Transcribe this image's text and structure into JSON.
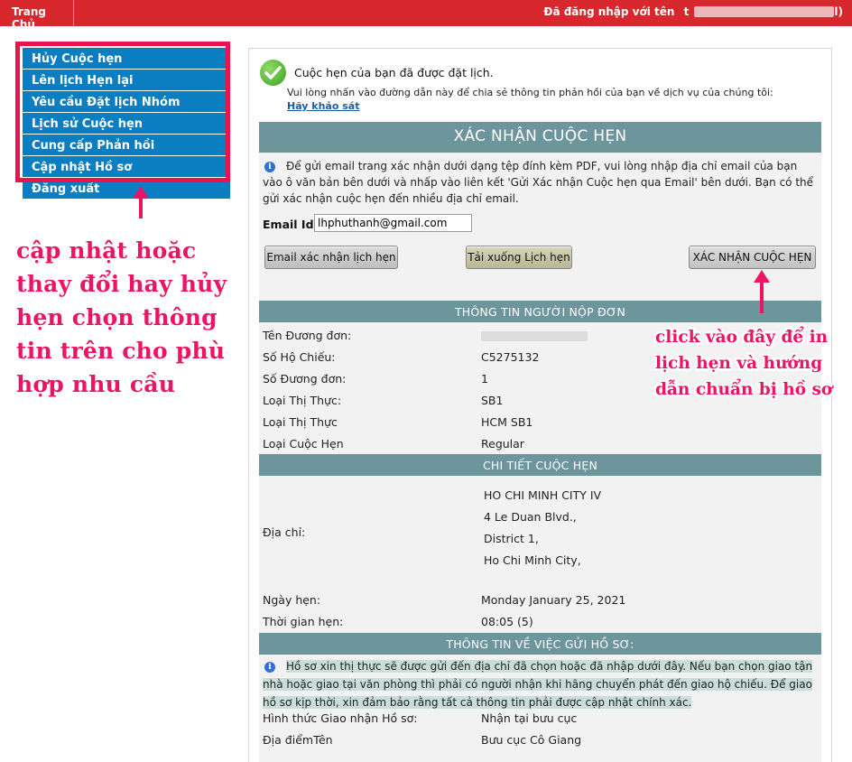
{
  "topbar": {
    "home_label": "Trang Chủ",
    "login_prefix": "Đã đăng nhập với tên",
    "login_start": "t",
    "login_end": "l)"
  },
  "sidebar": {
    "items": [
      {
        "label": "Hủy Cuộc hẹn"
      },
      {
        "label": "Lên lịch Hẹn lại"
      },
      {
        "label": "Yêu cầu Đặt lịch Nhóm"
      },
      {
        "label": "Lịch sử Cuộc hẹn"
      },
      {
        "label": "Cung cấp Phản hồi"
      },
      {
        "label": "Cập nhật Hồ sơ"
      },
      {
        "label": "Đăng xuất"
      }
    ]
  },
  "annotations": {
    "left": "cập nhật hoặc thay đổi hay hủy hẹn chọn thông tin trên cho phù hợp nhu cầu",
    "right": "click vào đây để in lịch hẹn và hướng dẫn chuẩn bị hồ sơ"
  },
  "confirm": {
    "title": "Cuộc hẹn của bạn đã được đặt lịch.",
    "survey_text": "Vui lòng nhấn vào đường dẫn này để chia sẻ thông tin phản hồi của bạn về dịch vụ của chúng tôi:",
    "survey_link": "Hãy khảo sát"
  },
  "card": {
    "title": "XÁC NHẬN CUỘC HẸN",
    "email_info": "Để gửi email trang xác nhận dưới dạng tệp đính kèm PDF, vui lòng nhập địa chỉ email của bạn vào ô văn bản bên dưới và nhấp vào liên kết 'Gửi Xác nhận Cuộc hẹn qua Email' bên dưới. Bạn có thể gửi xác nhận cuộc hẹn đến nhiều địa chỉ email.",
    "email_label": "Email Id:",
    "email_value": "lhphuthanh@gmail.com",
    "buttons": {
      "email": "Email xác nhận lịch hẹn",
      "download": "Tải xuống Lịch hẹn",
      "confirm": "XÁC NHẬN CUỘC HẸN"
    }
  },
  "applicant": {
    "heading": "THÔNG TIN NGƯỜI NỘP ĐƠN",
    "name_label": "Tên Đương đơn:",
    "passport_label": "Số Hộ Chiếu:",
    "passport_value": "C5275132",
    "app_no_label": "Số Đương đơn:",
    "app_no_value": "1",
    "visa_type_label": "Loại Thị Thực:",
    "visa_type_value": "SB1",
    "visa_class_label": "Loại Thị Thực",
    "visa_class_value": "HCM SB1",
    "appt_type_label": "Loại Cuộc Hẹn",
    "appt_type_value": "Regular"
  },
  "appointment": {
    "heading": "CHI TIẾT CUỘC HẸN",
    "address_label": "Địa chỉ:",
    "address_lines": [
      "HO CHI MINH CITY IV",
      "4 Le Duan Blvd.,",
      "District 1,",
      "Ho Chi Minh City,"
    ],
    "date_label": "Ngày hẹn:",
    "date_value": "Monday January 25, 2021",
    "time_label": "Thời gian hẹn:",
    "time_value": "08:05 (5)"
  },
  "documents": {
    "heading": "THÔNG TIN VỀ VIỆC GỬI HỒ SƠ:",
    "info": "Hồ sơ xin thị thực sẽ được gửi đến địa chỉ đã chọn hoặc đã nhập dưới đây. Nếu bạn chọn giao tận nhà hoặc giao tại văn phòng thì phải có người nhận khi hãng chuyển phát đến giao hộ chiếu. Để giao hồ sơ kịp thời, xin đảm bảo rằng tất cả thông tin phải được cập nhật chính xác.",
    "delivery_label": "Hình thức Giao nhận Hồ sơ:",
    "delivery_value": "Nhận tại bưu cục",
    "location_label": "Địa điểmTên",
    "location_value": "Bưu cục Cô Giang"
  }
}
